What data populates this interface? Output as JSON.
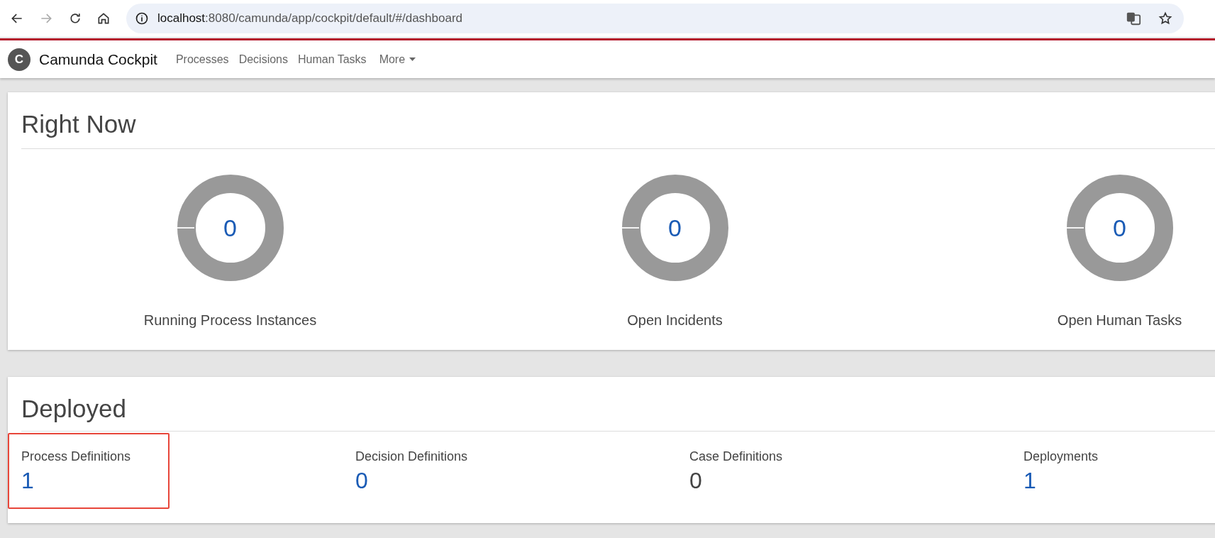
{
  "browser": {
    "url_host": "localhost",
    "url_rest": ":8080/camunda/app/cockpit/default/#/dashboard"
  },
  "app": {
    "title": "Camunda Cockpit",
    "logo_letter": "C",
    "nav": [
      {
        "label": "Processes",
        "kind": "link"
      },
      {
        "label": "Decisions",
        "kind": "link"
      },
      {
        "label": "Human Tasks",
        "kind": "link"
      },
      {
        "label": "More",
        "kind": "dropdown"
      }
    ]
  },
  "right_now": {
    "title": "Right Now",
    "metrics": [
      {
        "value": "0",
        "label": "Running Process Instances"
      },
      {
        "value": "0",
        "label": "Open Incidents"
      },
      {
        "value": "0",
        "label": "Open Human Tasks"
      }
    ]
  },
  "deployed": {
    "title": "Deployed",
    "items": [
      {
        "label": "Process Definitions",
        "value": "1",
        "link": true,
        "highlighted": true
      },
      {
        "label": "Decision Definitions",
        "value": "0",
        "link": true,
        "highlighted": false
      },
      {
        "label": "Case Definitions",
        "value": "0",
        "link": false,
        "highlighted": false
      },
      {
        "label": "Deployments",
        "value": "1",
        "link": true,
        "highlighted": false
      }
    ]
  }
}
